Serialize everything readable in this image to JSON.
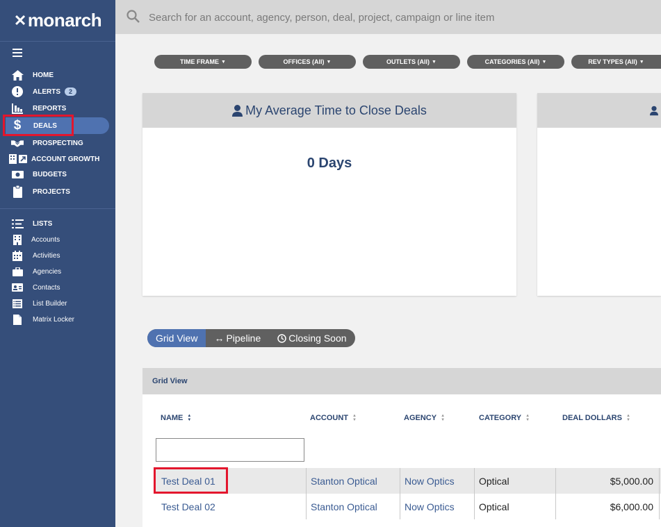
{
  "sidebar": {
    "logo": "monarch",
    "items": [
      {
        "label": "HOME",
        "icon": "home-icon"
      },
      {
        "label": "ALERTS",
        "icon": "alert-icon",
        "badge": "2"
      },
      {
        "label": "REPORTS",
        "icon": "reports-icon"
      },
      {
        "label": "DEALS",
        "icon": "dollar-icon",
        "active": true
      },
      {
        "label": "PROSPECTING",
        "icon": "handshake-icon"
      },
      {
        "label": "ACCOUNT GROWTH",
        "icon": "account-growth-icon"
      },
      {
        "label": "BUDGETS",
        "icon": "budget-icon"
      },
      {
        "label": "PROJECTS",
        "icon": "clipboard-icon"
      }
    ],
    "lists": [
      {
        "label": "LISTS",
        "icon": "list-icon"
      },
      {
        "label": "Accounts",
        "icon": "building-icon"
      },
      {
        "label": "Activities",
        "icon": "calendar-icon"
      },
      {
        "label": "Agencies",
        "icon": "briefcase-icon"
      },
      {
        "label": "Contacts",
        "icon": "contact-card-icon"
      },
      {
        "label": "List Builder",
        "icon": "list-builder-icon"
      },
      {
        "label": "Matrix Locker",
        "icon": "document-icon"
      }
    ]
  },
  "search": {
    "placeholder": "Search for an account, agency, person, deal, project, campaign or line item"
  },
  "filters": [
    "TIME FRAME",
    "OFFICES (All)",
    "OUTLETS (All)",
    "CATEGORIES (All)",
    "REV TYPES (All)"
  ],
  "card": {
    "title": "My Average Time to Close Deals",
    "value": "0 Days"
  },
  "views": [
    "Grid View",
    "Pipeline",
    "Closing Soon"
  ],
  "grid": {
    "title": "Grid View",
    "columns": [
      "NAME",
      "ACCOUNT",
      "AGENCY",
      "CATEGORY",
      "DEAL DOLLARS"
    ],
    "rows": [
      [
        "Test Deal 01",
        "Stanton Optical",
        "Now Optics",
        "Optical",
        "$5,000.00"
      ],
      [
        "Test Deal 02",
        "Stanton Optical",
        "Now Optics",
        "Optical",
        "$6,000.00"
      ]
    ]
  },
  "colors": {
    "sidebar": "#354e7a",
    "accent": "#4f72b0",
    "highlight": "#e3162d",
    "pill": "#606060"
  }
}
